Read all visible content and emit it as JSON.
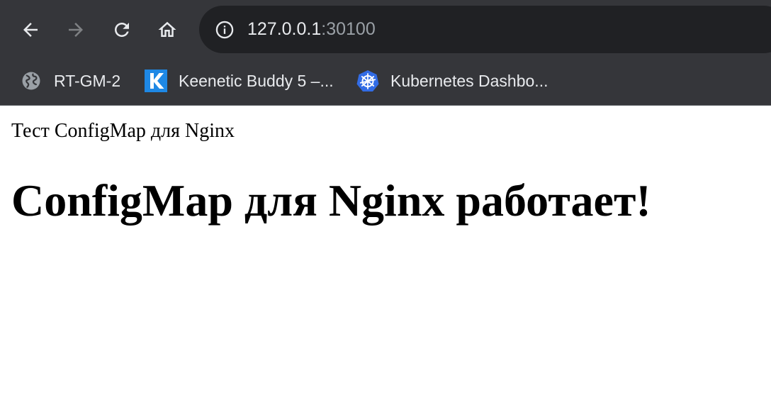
{
  "browser": {
    "nav": {
      "back_icon": "arrow-left-icon",
      "forward_icon": "arrow-right-icon",
      "reload_icon": "reload-icon",
      "home_icon": "home-icon"
    },
    "omnibox": {
      "info_icon": "info-icon",
      "host": "127.0.0.1",
      "port": ":30100"
    },
    "bookmarks": [
      {
        "label": "RT-GM-2",
        "icon": "globe-icon"
      },
      {
        "label": "Keenetic Buddy 5 –...",
        "icon": "keenetic-logo-icon"
      },
      {
        "label": "Kubernetes Dashbo...",
        "icon": "kubernetes-logo-icon"
      }
    ]
  },
  "page": {
    "text": "Тест ConfigMap для Nginx",
    "heading": "ConfigMap для Nginx работает!"
  },
  "colors": {
    "chrome_bg": "#35363a",
    "omnibox_bg": "#202124",
    "url_text": "#e8eaed",
    "url_port": "#9aa0a6",
    "keenetic_blue": "#1e88e5",
    "kubernetes_blue": "#326ce5"
  }
}
